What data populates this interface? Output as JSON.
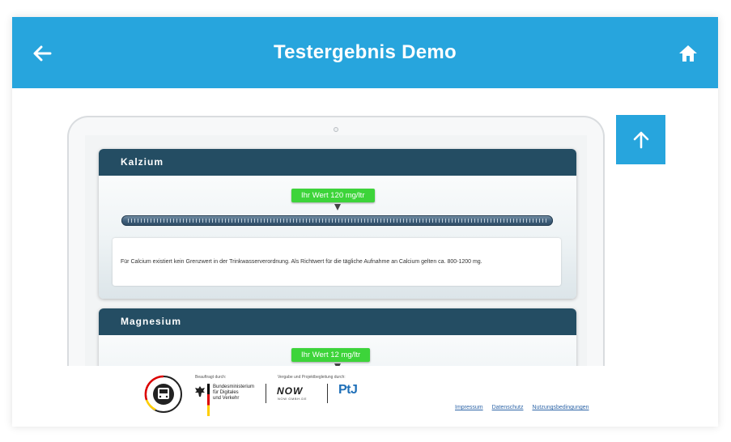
{
  "header": {
    "title": "Testergebnis Demo",
    "back_icon": "arrow-left-icon",
    "home_icon": "home-icon",
    "color": "#27a5dd"
  },
  "cards": [
    {
      "title": "Kalzium",
      "value_label": "Ihr Wert 120 mg/ltr",
      "value": 120,
      "level_fraction": 0.5,
      "description": "Für Calcium existiert kein Grenzwert in der Trinkwasserverordnung. Als Richtwert für die tägliche Aufnahme an Calcium gelten ca. 800-1200 mg."
    },
    {
      "title": "Magnesium",
      "value_label": "Ihr Wert 12 mg/ltr",
      "value": 12,
      "level_fraction": 0.5
    }
  ],
  "scroll_top_icon": "arrow-up-icon",
  "footer": {
    "funded_by": "Beauftragt durch:",
    "ministry": [
      "Bundesministerium",
      "für Digitales",
      "und Verkehr"
    ],
    "coordination": "Vergabe und Projektbegleitung durch:",
    "now_logo": "NOW",
    "now_sub": "NOW GMBH.DE",
    "ptj_logo": "PtJ",
    "links": {
      "impressum": "Impressum",
      "datenschutz": "Datenschutz",
      "nutzung": "Nutzungsbedingungen"
    }
  },
  "colors": {
    "accent": "#27a5dd",
    "card_header": "#244d63",
    "badge": "#3dd43a"
  }
}
